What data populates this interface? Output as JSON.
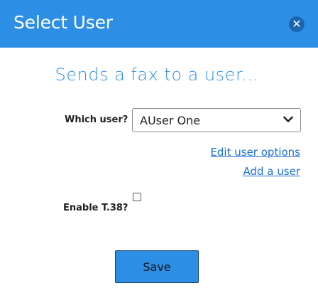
{
  "dialog": {
    "title": "Select User",
    "close_icon": "close-icon",
    "subtitle": "Sends a fax to a user..."
  },
  "form": {
    "user_label": "Which user?",
    "user_selected": "AUser One",
    "edit_link": "Edit user options",
    "add_link": "Add a user",
    "t38_label": "Enable T.38?",
    "t38_checked": false,
    "save_label": "Save"
  },
  "colors": {
    "header": "#2d8ee6",
    "accent": "#2d8ee6",
    "link": "#1a6fd6"
  }
}
